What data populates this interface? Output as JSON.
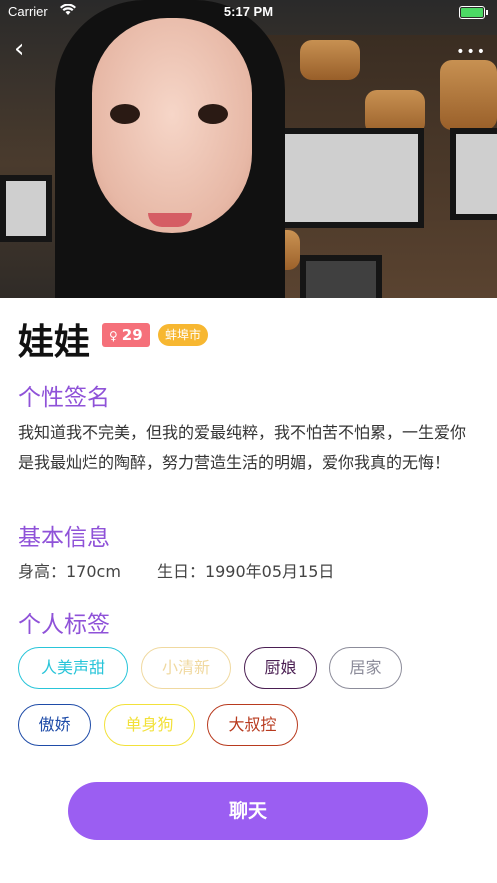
{
  "status_bar": {
    "carrier": "Carrier",
    "time": "5:17 PM"
  },
  "profile": {
    "name": "娃娃",
    "age": "29",
    "age_icon": "female-icon",
    "city": "蚌埠市"
  },
  "signature": {
    "title": "个性签名",
    "text": "我知道我不完美，但我的爱最纯粹，我不怕苦不怕累，一生爱你是我最灿烂的陶醉，努力营造生活的明媚，爱你我真的无悔！"
  },
  "basic_info": {
    "title": "基本信息",
    "height": "身高：170cm",
    "birthday": "生日：1990年05月15日"
  },
  "tags": {
    "title": "个人标签",
    "items": [
      {
        "label": "人美声甜",
        "color": "#29c5d9"
      },
      {
        "label": "小清新",
        "color": "#f0d9a0"
      },
      {
        "label": "厨娘",
        "color": "#4a1e52"
      },
      {
        "label": "居家",
        "color": "#8c8c9a"
      },
      {
        "label": "傲娇",
        "color": "#1f4ca8"
      },
      {
        "label": "单身狗",
        "color": "#f2e13a"
      },
      {
        "label": "大叔控",
        "color": "#b83a1e"
      }
    ]
  },
  "actions": {
    "chat": "聊天"
  },
  "colors": {
    "accent": "#9b5ef2",
    "section_title": "#8f52d8"
  }
}
